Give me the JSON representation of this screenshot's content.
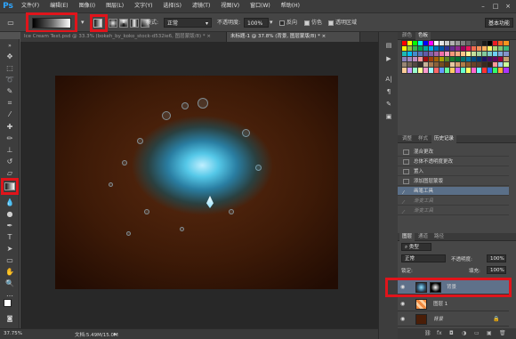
{
  "menubar": {
    "logo": "Ps",
    "items": [
      "文件(F)",
      "编辑(E)",
      "图像(I)",
      "图层(L)",
      "文字(Y)",
      "选择(S)",
      "滤镜(T)",
      "视图(V)",
      "窗口(W)",
      "帮助(H)"
    ],
    "minimize": "–",
    "maximize": "□",
    "close": "×"
  },
  "options": {
    "mode_label": "模式:",
    "mode_value": "正常",
    "opacity_label": "不透明度:",
    "opacity_value": "100%",
    "reverse_label": "反向",
    "dither_label": "仿色",
    "transparency_label": "透明区域",
    "workspace": "基本功能",
    "reverse_checked": false,
    "dither_checked": true,
    "transparency_checked": true
  },
  "document": {
    "tabs": [
      "Ice Cream Text.psd @ 33.3% (bokeh_by_koko_stock-d532ie6, 图层蒙版/8) *",
      "未标题-1 @ 37.8% (背景, 图层蒙版/8) *"
    ],
    "active_tab": 1,
    "close": "×"
  },
  "status": {
    "zoom": "37.75%",
    "doc": "文档:5.49M/15.0M"
  },
  "panels": {
    "top_tabs": [
      "颜色",
      "色板"
    ],
    "history_tabs": [
      "调整",
      "样式",
      "历史记录"
    ],
    "history_items": [
      {
        "label": "混合更改",
        "state": "normal"
      },
      {
        "label": "总体不透明度更改",
        "state": "normal"
      },
      {
        "label": "置入",
        "state": "normal"
      },
      {
        "label": "添加图层蒙版",
        "state": "normal"
      },
      {
        "label": "画笔工具",
        "state": "selected"
      },
      {
        "label": "渐变工具",
        "state": "dim"
      },
      {
        "label": "渐变工具",
        "state": "dim"
      }
    ],
    "layers_tabs": [
      "图层",
      "通道",
      "路径"
    ],
    "kind_label": "类型",
    "blend_value": "正常",
    "opacity_label": "不透明度:",
    "opacity_value": "100%",
    "lock_label": "锁定:",
    "fill_label": "填充:",
    "fill_value": "100%",
    "layers": [
      {
        "name": "背景",
        "selected": true
      },
      {
        "name": "图层 1",
        "selected": false
      },
      {
        "name": "背景",
        "selected": false,
        "italic": true
      }
    ]
  },
  "colors": {
    "accent_red": "#e0141b",
    "selected_row": "#5f718a",
    "ps_blue": "#2ea6ff"
  },
  "swatches": [
    "#ff0000",
    "#ffff00",
    "#00ff00",
    "#00ffff",
    "#0000ff",
    "#ff00ff",
    "#ffffff",
    "#e6e6e6",
    "#cccccc",
    "#b3b3b3",
    "#999999",
    "#808080",
    "#666666",
    "#4d4d4d",
    "#333333",
    "#1a1a1a",
    "#000000",
    "#ed1c24",
    "#f26522",
    "#f7941d",
    "#fff200",
    "#8dc63f",
    "#39b54a",
    "#00a651",
    "#00a99d",
    "#00aeef",
    "#0072bc",
    "#0054a6",
    "#2e3192",
    "#662d91",
    "#92278f",
    "#9e005d",
    "#ed145b",
    "#f26c4f",
    "#f68e56",
    "#fbaf5d",
    "#fff568",
    "#acd373",
    "#7cc576",
    "#3cb878",
    "#1abbb4",
    "#00bff3",
    "#448ccb",
    "#5674b9",
    "#605ca8",
    "#8560a8",
    "#a864a8",
    "#f06eaa",
    "#f49ac2",
    "#f7977a",
    "#f9ad81",
    "#fdc68a",
    "#fff79a",
    "#c4df9b",
    "#a3d39c",
    "#82ca9c",
    "#7accc8",
    "#6dcff6",
    "#7da7d9",
    "#8393ca",
    "#8781bd",
    "#a186be",
    "#bd8cbf",
    "#f5989d",
    "#9e0b0f",
    "#a0410d",
    "#a36209",
    "#aba000",
    "#598527",
    "#1a7b30",
    "#007236",
    "#00746b",
    "#0076a3",
    "#004a80",
    "#003471",
    "#1b1464",
    "#440e62",
    "#630460",
    "#9e0039",
    "#c69c6d",
    "#998675",
    "#736357",
    "#534741",
    "#362f2d",
    "#c7b299",
    "#a67c52",
    "#8c6239",
    "#754c24",
    "#603913",
    "#e6c8a0",
    "#d4a373",
    "#b07d48",
    "#8a5a2b",
    "#6b4226",
    "#5a3d2b",
    "#3b2a1e",
    "#2e1f16",
    "#ff9999",
    "#99ccff",
    "#ccff99",
    "#ffcc99",
    "#cc99ff",
    "#99ffcc",
    "#ffff99",
    "#ff99cc",
    "#99ffff",
    "#ff6666",
    "#6699ff",
    "#66ff99",
    "#ffcc66",
    "#cc66ff",
    "#66ffcc",
    "#ffff66",
    "#ff66cc",
    "#66ffff",
    "#ff3333",
    "#3366ff",
    "#33ff66",
    "#ffaa33",
    "#aa33ff"
  ]
}
